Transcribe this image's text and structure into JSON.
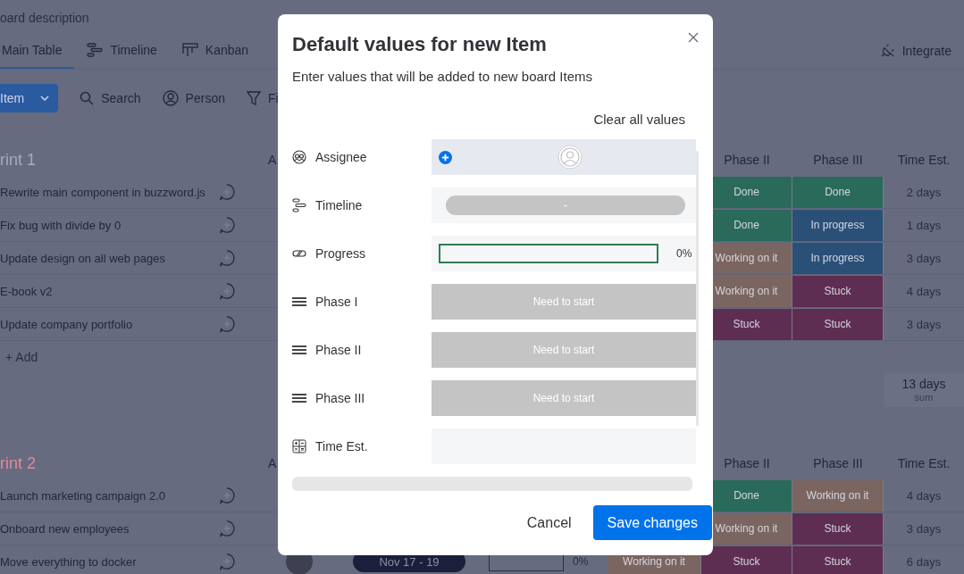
{
  "board": {
    "description": "oard description",
    "tabs": [
      {
        "label": "Main Table",
        "selected": true
      },
      {
        "label": "Timeline",
        "selected": false
      },
      {
        "label": "Kanban",
        "selected": false
      }
    ],
    "integrate": "Integrate",
    "toolbar": {
      "new_item": "Item",
      "search": "Search",
      "person": "Person",
      "filter": "Fi"
    },
    "groups": [
      {
        "title": "rint 1",
        "color": "#a9abbb",
        "column_a": "A",
        "columns": [
          "Phase II",
          "Phase III",
          "Time Est."
        ],
        "rows": [
          {
            "name": "Rewrite main component in buzzword.js",
            "phase_2": {
              "label": "Done",
              "color": "#2a6a5a"
            },
            "phase_3": {
              "label": "Done",
              "color": "#2a6a5a"
            },
            "time": "2 days"
          },
          {
            "name": "Fix bug with divide by 0",
            "phase_2": {
              "label": "Done",
              "color": "#2a6a5a"
            },
            "phase_3": {
              "label": "In progress",
              "color": "#2a5078"
            },
            "time": "1 days"
          },
          {
            "name": "Update design on all web pages",
            "phase_2": {
              "label": "Working on it",
              "color": "#7b6560"
            },
            "phase_3": {
              "label": "In progress",
              "color": "#2a5078"
            },
            "time": "3 days"
          },
          {
            "name": "E-book v2",
            "phase_2": {
              "label": "Working on it",
              "color": "#7b6560"
            },
            "phase_3": {
              "label": "Stuck",
              "color": "#5e2d52"
            },
            "time": "4 days"
          },
          {
            "name": "Update company portfolio",
            "phase_2": {
              "label": "Stuck",
              "color": "#5e2d52"
            },
            "phase_3": {
              "label": "Stuck",
              "color": "#5e2d52"
            },
            "time": "3 days"
          }
        ],
        "add": "+ Add",
        "sum": {
          "value": "13 days",
          "label": "sum"
        }
      },
      {
        "title": "rint 2",
        "color": "#e08a9c",
        "column_a": "A",
        "columns": [
          "Phase II",
          "Phase III",
          "Time Est."
        ],
        "rows": [
          {
            "name": "Launch marketing campaign 2.0",
            "phase_2": {
              "label": "Done",
              "color": "#2a6a5a"
            },
            "phase_3": {
              "label": "Working on it",
              "color": "#7b6560"
            },
            "time": "4 days"
          },
          {
            "name": "Onboard new employees",
            "phase_2": {
              "label": "Working on it",
              "color": "#7b6560"
            },
            "phase_3": {
              "label": "Stuck",
              "color": "#5e2d52"
            },
            "time": "3 days"
          },
          {
            "name": "Move everything to docker",
            "phase_2": {
              "label": "Stuck",
              "color": "#5e2d52"
            },
            "phase_3": {
              "label": "Stuck",
              "color": "#5e2d52"
            },
            "time": "6 days",
            "timeline": "Nov 17 - 19",
            "progress": {
              "level": 0,
              "reading": "0%"
            },
            "phase_1": {
              "label": "Working on it",
              "color": "#7b6560"
            }
          }
        ]
      }
    ]
  },
  "modal": {
    "title": "Default values for new Item",
    "subtitle": "Enter values that will be added to new board Items",
    "clear_label": "Clear all values",
    "fields": [
      {
        "kind": "people",
        "label": "Assignee"
      },
      {
        "kind": "timeline",
        "label": "Timeline",
        "value": "-"
      },
      {
        "kind": "progress",
        "label": "Progress",
        "level": 0,
        "reading": "0%"
      },
      {
        "kind": "status",
        "label": "Phase I",
        "value": "Need to start"
      },
      {
        "kind": "status",
        "label": "Phase II",
        "value": "Need to start"
      },
      {
        "kind": "status",
        "label": "Phase III",
        "value": "Need to start"
      },
      {
        "kind": "numbers",
        "label": "Time Est."
      }
    ],
    "buttons": {
      "cancel": "Cancel",
      "save": "Save changes"
    }
  }
}
